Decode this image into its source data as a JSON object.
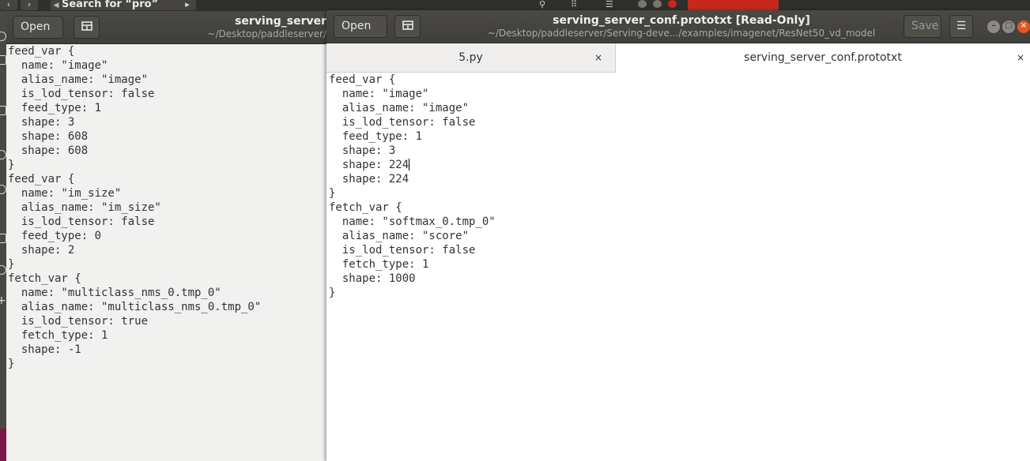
{
  "background_strip": {
    "search_label": "Search for “pro”"
  },
  "back_window": {
    "open_label": "Open",
    "title": "serving_server",
    "subtitle": "~/Desktop/paddleserver/",
    "lines": [
      "feed_var {",
      "  name: \"image\"",
      "  alias_name: \"image\"",
      "  is_lod_tensor: false",
      "  feed_type: 1",
      "  shape: 3",
      "  shape: 608",
      "  shape: 608",
      "}",
      "feed_var {",
      "  name: \"im_size\"",
      "  alias_name: \"im_size\"",
      "  is_lod_tensor: false",
      "  feed_type: 0",
      "  shape: 2",
      "}",
      "fetch_var {",
      "  name: \"multiclass_nms_0.tmp_0\"",
      "  alias_name: \"multiclass_nms_0.tmp_0\"",
      "  is_lod_tensor: true",
      "  fetch_type: 1",
      "  shape: -1",
      "}"
    ]
  },
  "front_window": {
    "open_label": "Open",
    "title": "serving_server_conf.prototxt [Read-Only]",
    "subtitle": "~/Desktop/paddleserver/Serving-deve.../examples/imagenet/ResNet50_vd_model",
    "save_label": "Save",
    "tabs": [
      {
        "label": "5.py",
        "close": "×"
      },
      {
        "label": "serving_server_conf.prototxt",
        "close": "×"
      }
    ],
    "lines_before_cursor": "feed_var {\n  name: \"image\"\n  alias_name: \"image\"\n  is_lod_tensor: false\n  feed_type: 1\n  shape: 3\n  shape: 224",
    "lines_after_cursor": "\n  shape: 224\n}\nfetch_var {\n  name: \"softmax_0.tmp_0\"\n  alias_name: \"score\"\n  is_lod_tensor: false\n  fetch_type: 1\n  shape: 1000\n}"
  },
  "colors": {
    "headerbar": "#403f3b",
    "text": "#2e3436",
    "close_button": "#e95420"
  }
}
